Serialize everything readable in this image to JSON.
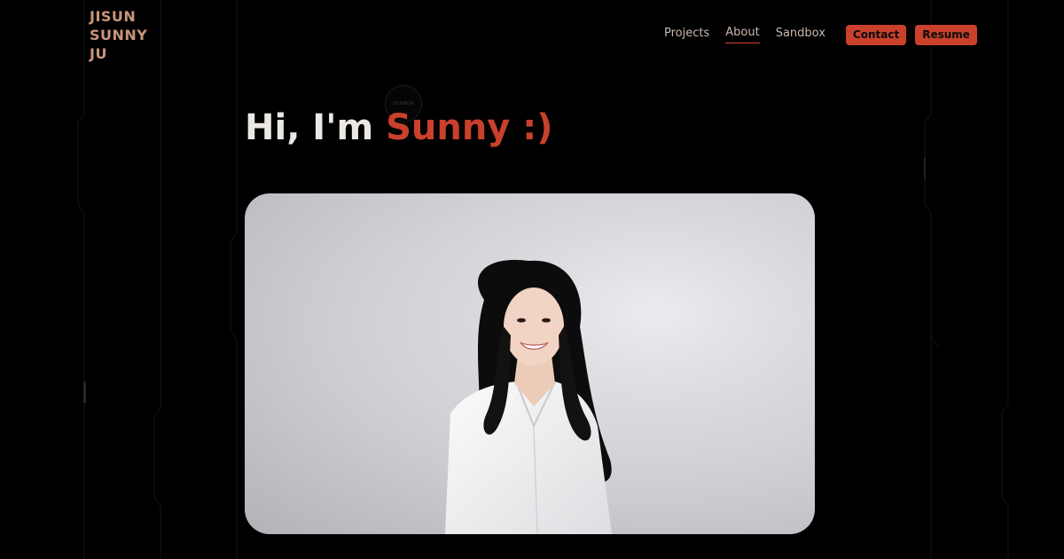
{
  "logo": {
    "line1": "JISUN",
    "line2": "SUNNY",
    "line3": "JU"
  },
  "nav": {
    "projects": "Projects",
    "about": "About",
    "sandbox": "Sandbox",
    "contact": "Contact",
    "resume": "Resume",
    "active": "About"
  },
  "hero": {
    "greeting": "Hi, I'm",
    "name": "Sunny :)",
    "badge": "SUNNOR"
  },
  "colors": {
    "background": "#000000",
    "accent": "#c9402c",
    "logo": "#c9957a",
    "headline": "#ebe7e3"
  }
}
